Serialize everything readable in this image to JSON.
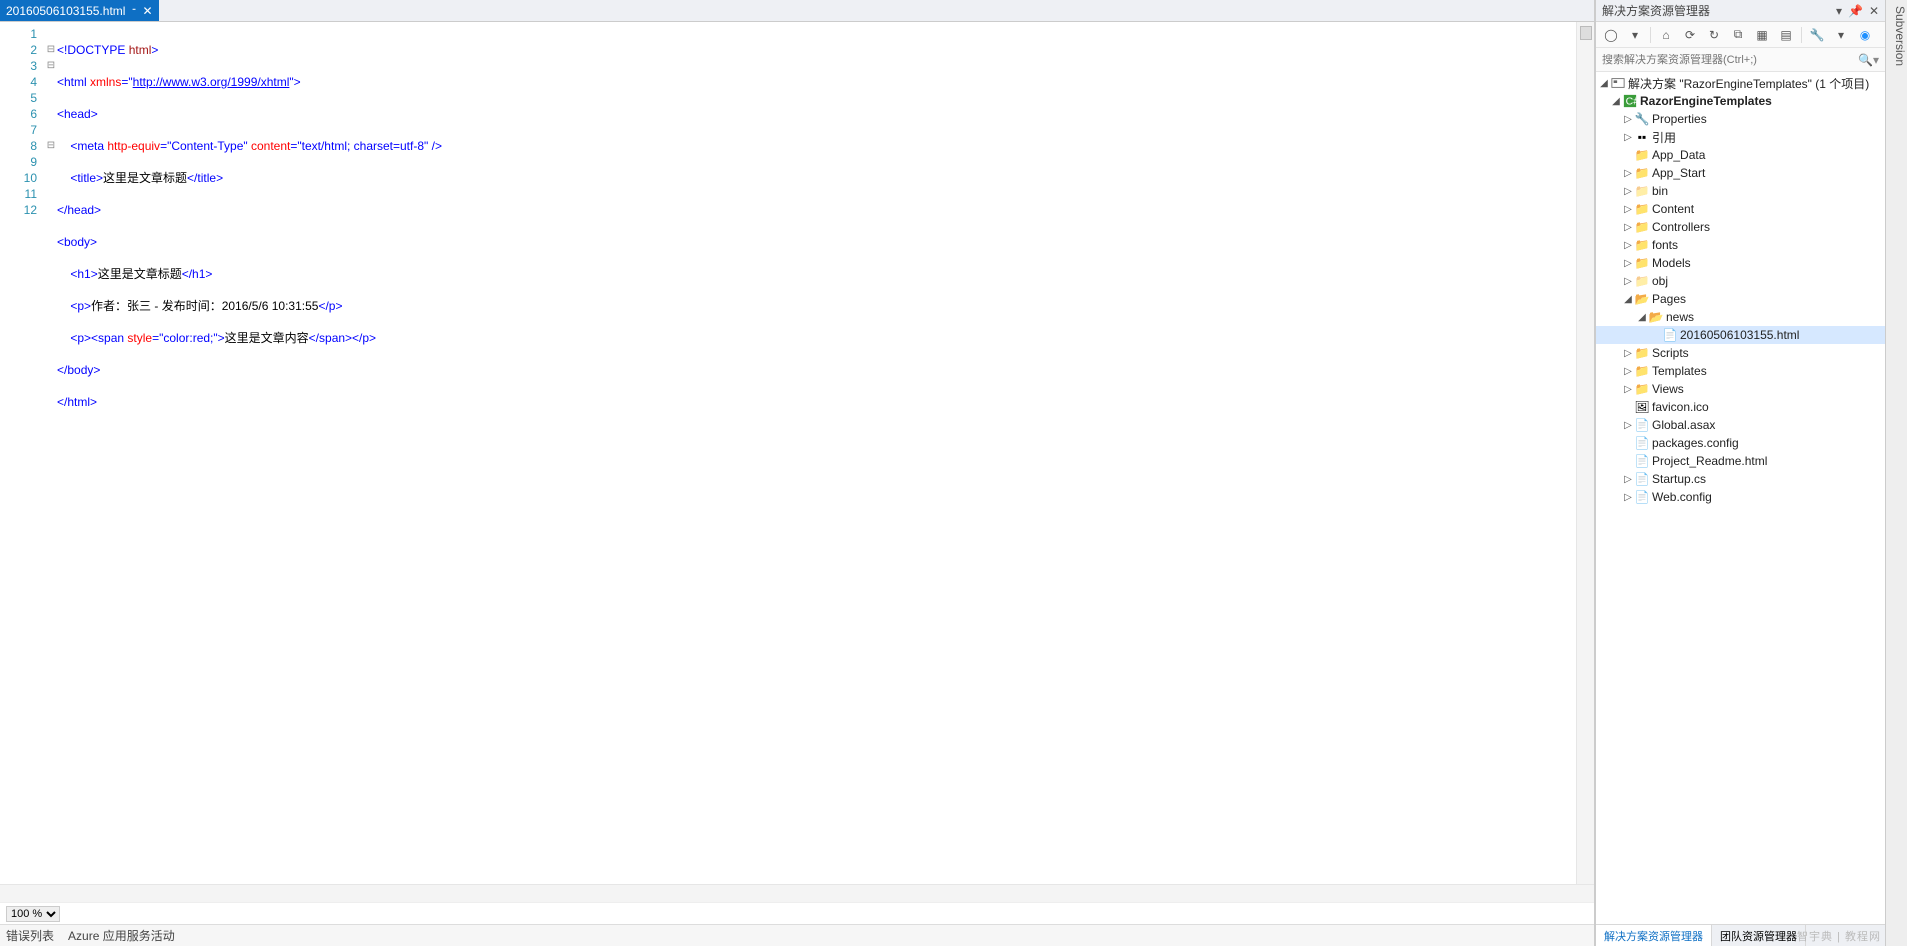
{
  "tab": {
    "filename": "20160506103155.html",
    "pin": "⁃",
    "close": "✕"
  },
  "code": {
    "lines": [
      "1",
      "2",
      "3",
      "4",
      "5",
      "6",
      "7",
      "8",
      "9",
      "10",
      "11",
      "12"
    ],
    "l1_a": "<!DOCTYPE ",
    "l1_b": "html",
    "l1_c": ">",
    "l2_a": "<html ",
    "l2_attr": "xmlns",
    "l2_eq": "=",
    "l2_q": "\"",
    "l2_url": "http://www.w3.org/1999/xhtml",
    "l2_c": ">",
    "l3": "<head>",
    "l4_a": "    <meta ",
    "l4_attr1": "http-equiv",
    "l4_v1": "\"Content-Type\"",
    "l4_attr2": "content",
    "l4_v2": "\"text/html; charset=utf-8\"",
    "l4_c": " />",
    "l5_a": "    <title>",
    "l5_txt": "这里是文章标题",
    "l5_b": "</title>",
    "l6": "</head>",
    "l7": "<body>",
    "l8_a": "    <h1>",
    "l8_txt": "这里是文章标题",
    "l8_b": "</h1>",
    "l9_a": "    <p>",
    "l9_txt": "作者：张三 - 发布时间：2016/5/6 10:31:55",
    "l9_b": "</p>",
    "l10_a": "    <p><span ",
    "l10_attr": "style",
    "l10_v": "\"color:red;\"",
    "l10_m": ">",
    "l10_txt": "这里是文章内容",
    "l10_b": "</span></p>",
    "l11": "</body>",
    "l12": "</html>"
  },
  "zoom": "100 %",
  "status": {
    "errors": "错误列表",
    "azure": "Azure 应用服务活动"
  },
  "panel": {
    "title": "解决方案资源管理器",
    "search_placeholder": "搜索解决方案资源管理器(Ctrl+;)",
    "solution": "解决方案 \"RazorEngineTemplates\" (1 个项目)",
    "project": "RazorEngineTemplates",
    "items": {
      "properties": "Properties",
      "refs": "引用",
      "appdata": "App_Data",
      "appstart": "App_Start",
      "bin": "bin",
      "content": "Content",
      "controllers": "Controllers",
      "fonts": "fonts",
      "models": "Models",
      "obj": "obj",
      "pages": "Pages",
      "news": "news",
      "htmlfile": "20160506103155.html",
      "scripts": "Scripts",
      "templates": "Templates",
      "views": "Views",
      "favicon": "favicon.ico",
      "global": "Global.asax",
      "packages": "packages.config",
      "readme": "Project_Readme.html",
      "startup": "Startup.cs",
      "webconfig": "Web.config"
    },
    "tabs": {
      "a": "解决方案资源管理器",
      "b": "团队资源管理器"
    }
  },
  "sidebar_label": "Subversion",
  "watermark": "智宇典 | 教程网"
}
